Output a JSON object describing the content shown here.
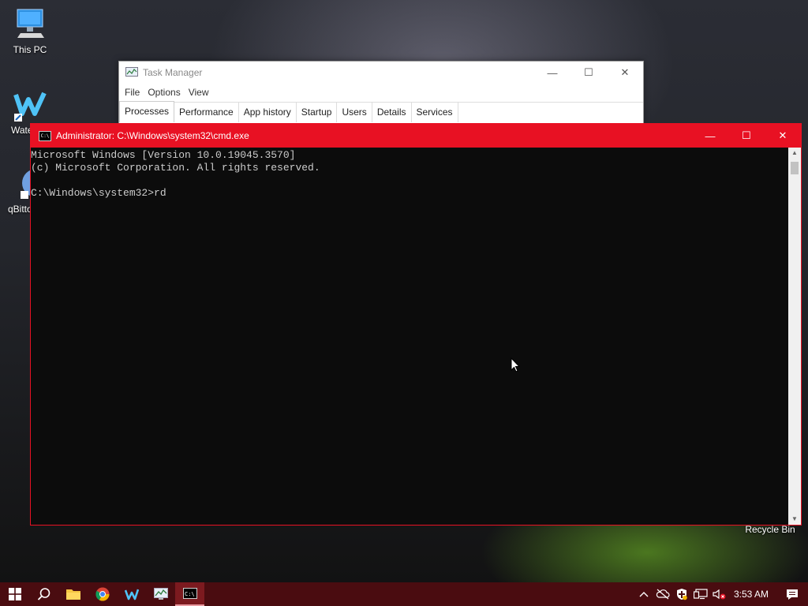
{
  "desktop": {
    "icons": [
      {
        "label": "This PC"
      },
      {
        "label": "Wate"
      },
      {
        "label": "qBitto"
      },
      {
        "label": "Recycle Bin"
      }
    ]
  },
  "task_manager": {
    "title": "Task Manager",
    "menu": [
      "File",
      "Options",
      "View"
    ],
    "tabs": [
      "Processes",
      "Performance",
      "App history",
      "Startup",
      "Users",
      "Details",
      "Services"
    ],
    "active_tab": "Processes"
  },
  "cmd": {
    "title": "Administrator: C:\\Windows\\system32\\cmd.exe",
    "accent_color": "#e81123",
    "lines": [
      "Microsoft Windows [Version 10.0.19045.3570]",
      "(c) Microsoft Corporation. All rights reserved.",
      "",
      "C:\\Windows\\system32>rd"
    ]
  },
  "taskbar": {
    "color": "#4a0c10",
    "pinned": [
      "windows-start-icon",
      "search-icon",
      "file-explorer-icon",
      "chrome-icon",
      "app-icon",
      "task-manager-icon",
      "cmd-icon"
    ],
    "clock": "3:53 AM"
  }
}
